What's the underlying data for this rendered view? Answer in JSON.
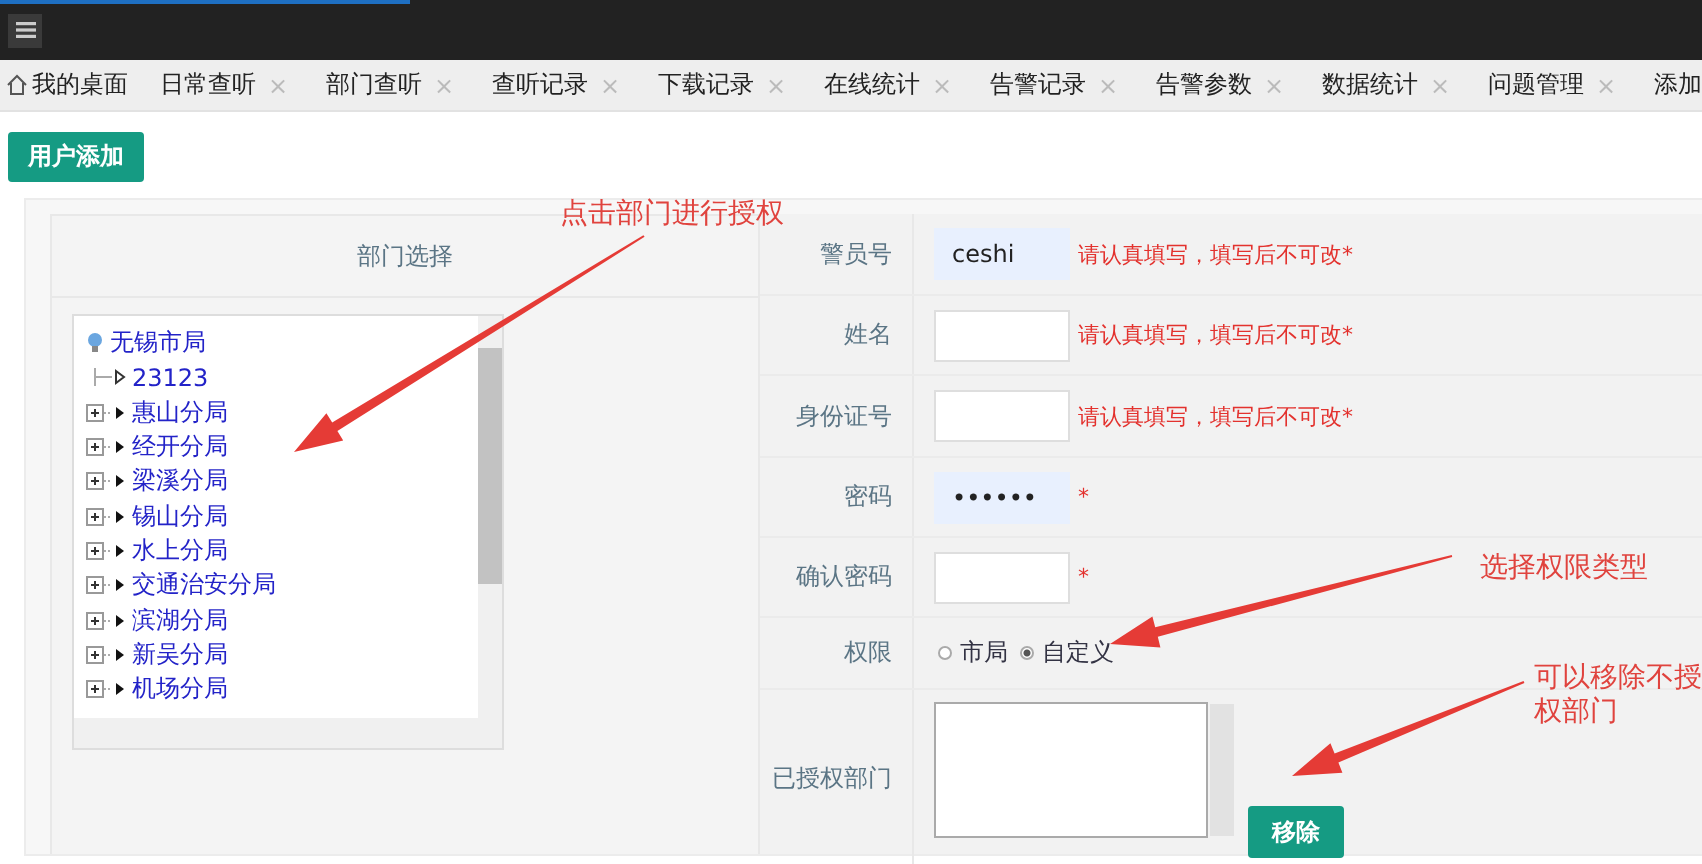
{
  "tabs": [
    {
      "kind": "home",
      "label": "我的桌面"
    },
    {
      "kind": "closable",
      "label": "日常查听",
      "close": "×"
    },
    {
      "kind": "closable",
      "label": "部门查听",
      "close": "×"
    },
    {
      "kind": "closable",
      "label": "查听记录",
      "close": "×"
    },
    {
      "kind": "closable",
      "label": "下载记录",
      "close": "×"
    },
    {
      "kind": "closable",
      "label": "在线统计",
      "close": "×"
    },
    {
      "kind": "closable",
      "label": "告警记录",
      "close": "×"
    },
    {
      "kind": "closable",
      "label": "告警参数",
      "close": "×"
    },
    {
      "kind": "closable",
      "label": "数据统计",
      "close": "×"
    },
    {
      "kind": "closable",
      "label": "问题管理",
      "close": "×"
    },
    {
      "kind": "closable",
      "label": "添加"
    }
  ],
  "add_button": "用户添加",
  "dept_panel": {
    "title": "部门选择",
    "tree": {
      "label": "无锡市局",
      "children": [
        {
          "label": "23123",
          "expandable": false
        },
        {
          "label": "惠山分局",
          "expandable": true
        },
        {
          "label": "经开分局",
          "expandable": true
        },
        {
          "label": "梁溪分局",
          "expandable": true
        },
        {
          "label": "锡山分局",
          "expandable": true
        },
        {
          "label": "水上分局",
          "expandable": true
        },
        {
          "label": "交通治安分局",
          "expandable": true
        },
        {
          "label": "滨湖分局",
          "expandable": true
        },
        {
          "label": "新吴分局",
          "expandable": true
        },
        {
          "label": "机场分局",
          "expandable": true
        }
      ]
    }
  },
  "form": {
    "rows": [
      {
        "kind": "input",
        "label": "警员号",
        "value": "ceshi",
        "filled": true,
        "hint": "请认真填写，填写后不可改*"
      },
      {
        "kind": "input",
        "label": "姓名",
        "filled": false,
        "hint": "请认真填写，填写后不可改*"
      },
      {
        "kind": "input",
        "label": "身份证号",
        "filled": false,
        "hint": "请认真填写，填写后不可改*"
      },
      {
        "kind": "input",
        "label": "密码",
        "value": "••••••",
        "filled": true,
        "hint": "*"
      },
      {
        "kind": "input",
        "label": "确认密码",
        "filled": false,
        "hint": "*"
      },
      {
        "kind": "radio",
        "label": "权限",
        "options": [
          {
            "label": "市局",
            "selected": false
          },
          {
            "label": "自定义",
            "selected": true
          }
        ]
      },
      {
        "kind": "list",
        "label": "已授权部门",
        "button": "移除"
      }
    ]
  },
  "annotations": [
    {
      "text": "点击部门进行授权"
    },
    {
      "text": "选择权限类型"
    },
    {
      "text": "可以移除不授权部门"
    }
  ]
}
